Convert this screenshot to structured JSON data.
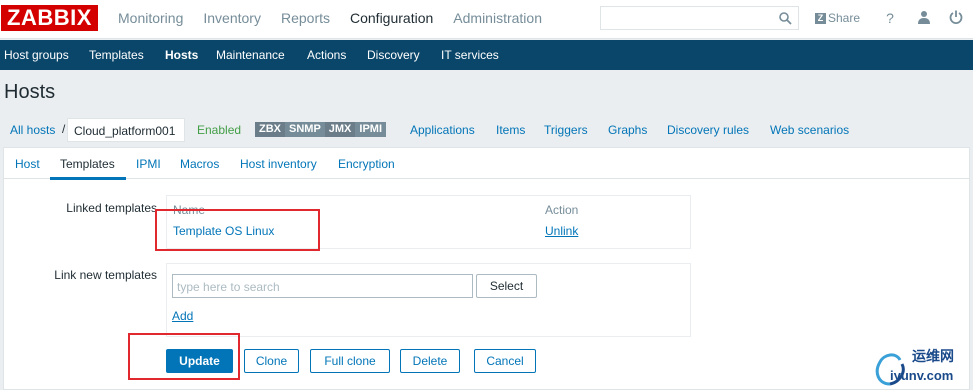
{
  "app": {
    "logo": "ZABBIX"
  },
  "top_menu": {
    "items": [
      "Monitoring",
      "Inventory",
      "Reports",
      "Configuration",
      "Administration"
    ],
    "active": "Configuration"
  },
  "search": {
    "placeholder": ""
  },
  "share_label": "Share",
  "nav": {
    "items": [
      "Host groups",
      "Templates",
      "Hosts",
      "Maintenance",
      "Actions",
      "Discovery",
      "IT services"
    ],
    "active": "Hosts"
  },
  "page_title": "Hosts",
  "host_nav": {
    "all_hosts": "All hosts",
    "separator": "/",
    "host_name": "Cloud_platform001",
    "status": "Enabled",
    "availability": [
      "ZBX",
      "SNMP",
      "JMX",
      "IPMI"
    ],
    "links": [
      "Applications",
      "Items",
      "Triggers",
      "Graphs",
      "Discovery rules",
      "Web scenarios"
    ]
  },
  "tabs": {
    "items": [
      "Host",
      "Templates",
      "IPMI",
      "Macros",
      "Host inventory",
      "Encryption"
    ],
    "active": "Templates"
  },
  "linked_templates": {
    "label": "Linked templates",
    "col_name": "Name",
    "col_action": "Action",
    "rows": [
      {
        "name": "Template OS Linux",
        "action": "Unlink"
      }
    ]
  },
  "link_new": {
    "label": "Link new templates",
    "placeholder": "type here to search",
    "select_label": "Select",
    "add_label": "Add"
  },
  "buttons": {
    "update": "Update",
    "clone": "Clone",
    "full_clone": "Full clone",
    "delete": "Delete",
    "cancel": "Cancel"
  },
  "watermark": {
    "line1": "运维网",
    "line2": "iyunv.com"
  },
  "colors": {
    "brand_red": "#d40000",
    "nav_bg": "#0a466a",
    "link": "#0275b8",
    "enabled": "#429e47",
    "highlight": "#e0282e"
  }
}
